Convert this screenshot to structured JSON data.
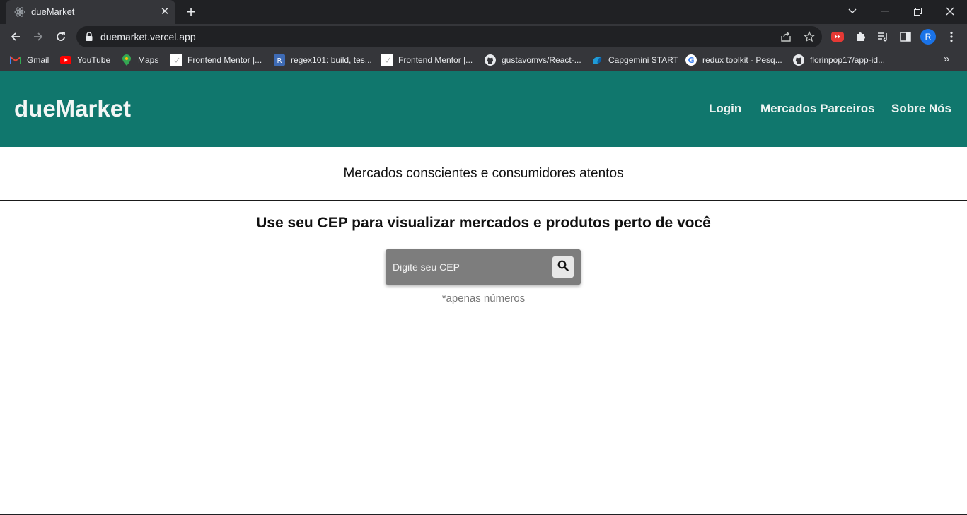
{
  "browser": {
    "tab_title": "dueMarket",
    "url": "duemarket.vercel.app",
    "profile_initial": "R",
    "bookmarks": [
      {
        "label": "Gmail",
        "icon": "gmail-icon"
      },
      {
        "label": "YouTube",
        "icon": "youtube-icon"
      },
      {
        "label": "Maps",
        "icon": "maps-icon"
      },
      {
        "label": "Frontend Mentor |...",
        "icon": "page-icon"
      },
      {
        "label": "regex101: build, tes...",
        "icon": "regex-icon"
      },
      {
        "label": "Frontend Mentor |...",
        "icon": "page-icon"
      },
      {
        "label": "gustavomvs/React-...",
        "icon": "github-icon"
      },
      {
        "label": "Capgemini START",
        "icon": "capgemini-icon"
      },
      {
        "label": "redux toolkit - Pesq...",
        "icon": "google-icon"
      },
      {
        "label": "florinpop17/app-id...",
        "icon": "github-icon"
      }
    ],
    "bookmarks_more": "»"
  },
  "site": {
    "logo": "dueMarket",
    "nav": {
      "login": "Login",
      "partners": "Mercados Parceiros",
      "about": "Sobre Nós"
    },
    "tagline": "Mercados conscientes e consumidores atentos",
    "headline": "Use seu CEP para visualizar mercados e produtos perto de você",
    "cep_placeholder": "Digite seu CEP",
    "cep_value": "",
    "hint": "*apenas números"
  },
  "colors": {
    "header_bg": "#10776d",
    "cep_box_bg": "#7d7d7d",
    "chrome_dark": "#202124",
    "chrome_toolbar": "#35363a"
  }
}
